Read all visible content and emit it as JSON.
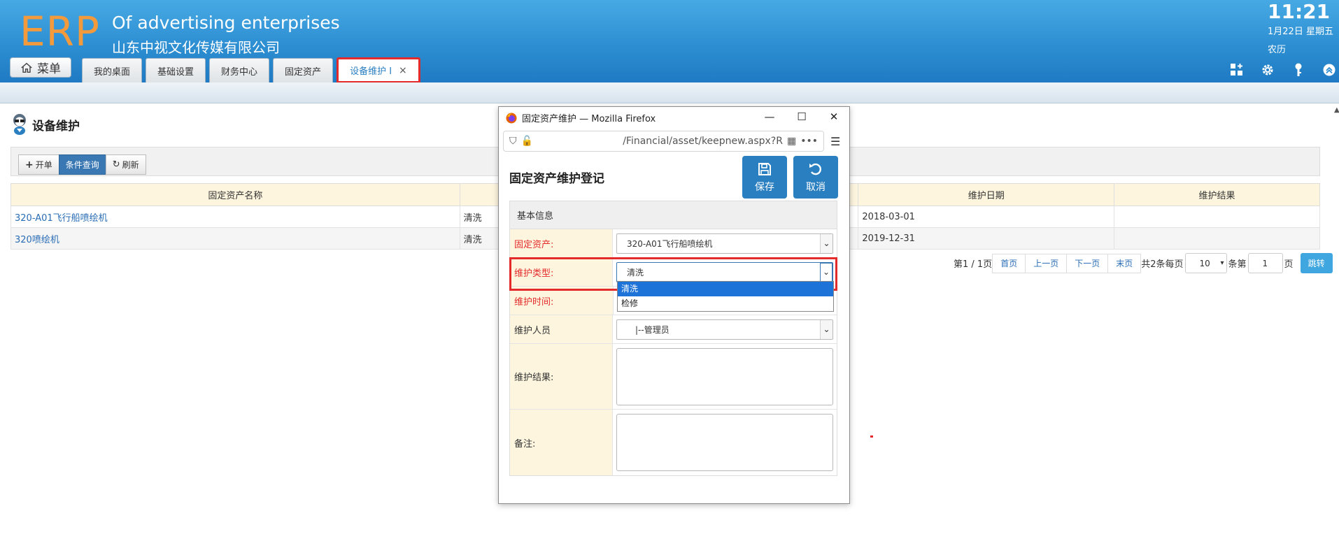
{
  "header": {
    "logo": "ERP",
    "company_en": "Of advertising enterprises",
    "company_cn": "山东中视文化传媒有限公司",
    "clock": "11:21",
    "date": "1月22日 星期五",
    "lunar": "农历",
    "menu_label": "菜单",
    "tabs": [
      {
        "label": "我的桌面"
      },
      {
        "label": "基础设置"
      },
      {
        "label": "财务中心"
      },
      {
        "label": "固定资产"
      },
      {
        "label": "设备维护 I",
        "active": true,
        "close": "×"
      }
    ]
  },
  "page": {
    "title": "设备维护",
    "toolbar": {
      "new_label": "开单",
      "query_label": "条件查询",
      "refresh_label": "刷新"
    },
    "table": {
      "columns": [
        "固定资产名称",
        "",
        "维护日期",
        "维护结果"
      ],
      "rows": [
        {
          "name": "320-A01飞行船喷绘机",
          "type": "清洗",
          "date": "2018-03-01",
          "result": ""
        },
        {
          "name": "320喷绘机",
          "type": "清洗",
          "date": "2019-12-31",
          "result": ""
        }
      ]
    },
    "pager": {
      "page_info": "第1 / 1页",
      "first": "首页",
      "prev": "上一页",
      "next": "下一页",
      "last": "末页",
      "total": "共2条每页",
      "page_size": "10",
      "per_page_suffix": "条第",
      "page_input": "1",
      "page_suffix": "页",
      "go": "跳转"
    }
  },
  "popup": {
    "window_title": "固定资产维护 — Mozilla Firefox",
    "url": "/Financial/asset/keepnew.aspx?R",
    "form_title": "固定资产维护登记",
    "save_label": "保存",
    "cancel_label": "取消",
    "section": "基本信息",
    "fields": {
      "asset_label": "固定资产:",
      "asset_value": "320-A01飞行船喷绘机",
      "type_label": "维护类型:",
      "type_value": "清洗",
      "time_label": "维护时间:",
      "person_label": "维护人员",
      "person_value": "|--管理员",
      "result_label": "维护结果:",
      "note_label": "备注:"
    },
    "dropdown_options": [
      "清洗",
      "检修"
    ]
  }
}
